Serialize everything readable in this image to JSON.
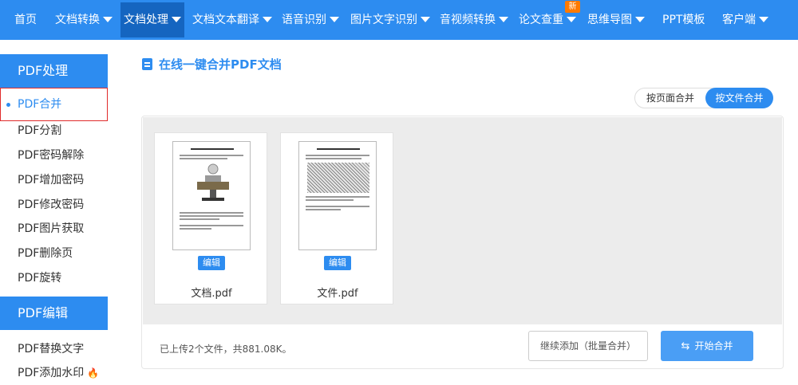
{
  "nav": {
    "items": [
      {
        "label": "首页",
        "caret": false
      },
      {
        "label": "文档转换",
        "caret": true
      },
      {
        "label": "文档处理",
        "caret": true
      },
      {
        "label": "文档文本翻译",
        "caret": true
      },
      {
        "label": "语音识别",
        "caret": true
      },
      {
        "label": "图片文字识别",
        "caret": true
      },
      {
        "label": "音视频转换",
        "caret": true
      },
      {
        "label": "论文查重",
        "caret": true
      },
      {
        "label": "思维导图",
        "caret": true
      },
      {
        "label": "PPT模板",
        "caret": false
      },
      {
        "label": "客户端",
        "caret": true
      }
    ],
    "active_index": 2,
    "new_badge": "新"
  },
  "sidebar": {
    "section1_title": "PDF处理",
    "section1_items": [
      "PDF合并",
      "PDF分割",
      "PDF密码解除",
      "PDF增加密码",
      "PDF修改密码",
      "PDF图片获取",
      "PDF删除页",
      "PDF旋转"
    ],
    "section2_title": "PDF编辑",
    "section2_items": [
      "PDF替换文字",
      "PDF添加水印"
    ],
    "hot_icon": "fire-icon"
  },
  "main": {
    "title": "在线一键合并PDF文档",
    "toggle": {
      "by_page": "按页面合并",
      "by_file": "按文件合并",
      "selected": "by_file"
    },
    "files": [
      {
        "name": "文档.pdf",
        "edit_label": "编辑"
      },
      {
        "name": "文件.pdf",
        "edit_label": "编辑"
      }
    ],
    "status": "已上传2个文件，共881.08K。",
    "add_button": "继续添加（批量合并）",
    "merge_button": "开始合并"
  },
  "colors": {
    "primary": "#2d8cf0",
    "active_nav": "#1565c0",
    "badge": "#ff7a00",
    "highlight_border": "#e02b2b"
  }
}
